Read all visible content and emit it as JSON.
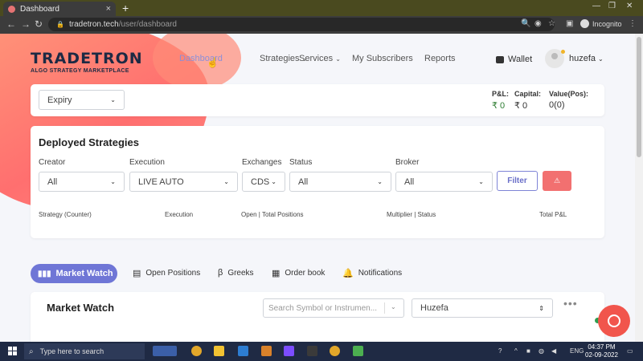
{
  "browser": {
    "tab_title": "Dashboard",
    "new_tab": "+",
    "url_host": "tradetron.tech",
    "url_path": "/user/dashboard",
    "profile_label": "Incognito"
  },
  "brand": {
    "name": "TRADETRON",
    "tagline": "ALGO STRATEGY MARKETPLACE",
    "accent": "#6f76d6",
    "danger": "#f27070"
  },
  "nav": {
    "dashboard": "Dashboard",
    "strategies": "Strategies",
    "services": "Services",
    "subscribers": "My Subscribers",
    "reports": "Reports",
    "wallet": "Wallet",
    "username": "huzefa"
  },
  "summary": {
    "expiry_select": "Expiry",
    "pl_label": "P&L:",
    "pl_value": "₹ 0",
    "capital_label": "Capital:",
    "capital_value": "₹ 0",
    "valuepos_label": "Value(Pos):",
    "valuepos_value": "0(0)"
  },
  "deployed": {
    "title": "Deployed Strategies",
    "filters": {
      "creator": {
        "label": "Creator",
        "value": "All"
      },
      "execution": {
        "label": "Execution",
        "value": "LIVE AUTO"
      },
      "exchanges": {
        "label": "Exchanges",
        "value": "CDS"
      },
      "status": {
        "label": "Status",
        "value": "All"
      },
      "broker": {
        "label": "Broker",
        "value": "All"
      }
    },
    "filter_button": "Filter",
    "columns": [
      "Strategy (Counter)",
      "Execution",
      "Open | Total Positions",
      "Multiplier | Status",
      "Total P&L"
    ]
  },
  "tabs": [
    "Market Watch",
    "Open Positions",
    "Greeks",
    "Order book",
    "Notifications"
  ],
  "market_watch": {
    "title": "Market Watch",
    "search_placeholder": "Search Symbol or Instrumen...",
    "list_select": "Huzefa",
    "more": "•••"
  },
  "taskbar": {
    "search_placeholder": "Type here to search",
    "lang": "ENG",
    "time": "04:37 PM",
    "date": "02-09-2022"
  }
}
